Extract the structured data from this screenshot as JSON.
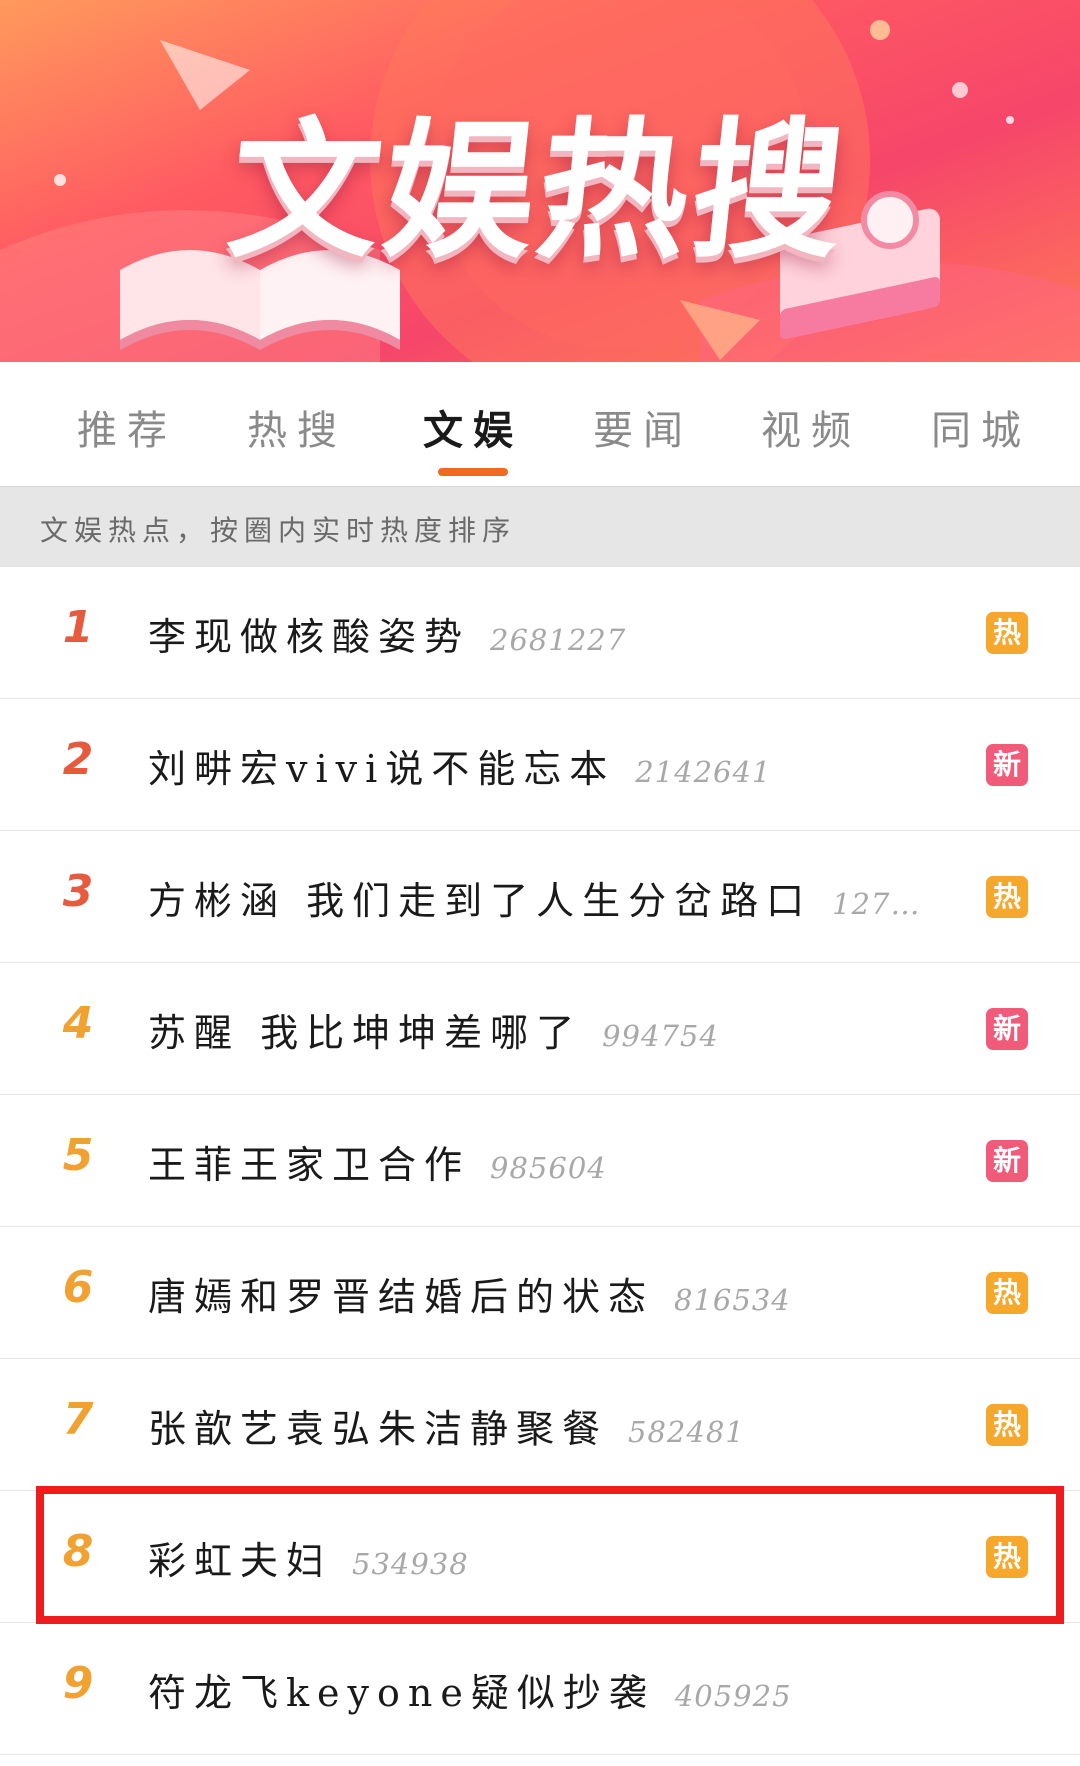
{
  "banner": {
    "title": "文娱热搜",
    "colors": {
      "primary": "#f6466a",
      "secondary": "#ff9a5c"
    }
  },
  "tabs": [
    {
      "label": "推荐",
      "active": false
    },
    {
      "label": "热搜",
      "active": false
    },
    {
      "label": "文娱",
      "active": true
    },
    {
      "label": "要闻",
      "active": false
    },
    {
      "label": "视频",
      "active": false
    },
    {
      "label": "同城",
      "active": false
    }
  ],
  "info": {
    "text": "文娱热点，按圈内实时热度排序"
  },
  "list": [
    {
      "rank": "1",
      "title": "李现做核酸姿势",
      "count": "2681227",
      "badge": "热"
    },
    {
      "rank": "2",
      "title": "刘畊宏vivi说不能忘本",
      "count": "2142641",
      "badge": "新"
    },
    {
      "rank": "3",
      "title": "方彬涵 我们走到了人生分岔路口",
      "count": "127…",
      "badge": "热"
    },
    {
      "rank": "4",
      "title": "苏醒 我比坤坤差哪了",
      "count": "994754",
      "badge": "新"
    },
    {
      "rank": "5",
      "title": "王菲王家卫合作",
      "count": "985604",
      "badge": "新"
    },
    {
      "rank": "6",
      "title": "唐嫣和罗晋结婚后的状态",
      "count": "816534",
      "badge": "热"
    },
    {
      "rank": "7",
      "title": "张歆艺袁弘朱洁静聚餐",
      "count": "582481",
      "badge": "热"
    },
    {
      "rank": "8",
      "title": "彩虹夫妇",
      "count": "534938",
      "badge": "热"
    },
    {
      "rank": "9",
      "title": "符龙飞keyone疑似抄袭",
      "count": "405925",
      "badge": ""
    }
  ],
  "colors": {
    "tab_indicator": "#f06a20",
    "rank_top": "#e85a3e",
    "rank": "#f1a130",
    "badge_hot": "#f7a72c",
    "badge_new": "#f25a7a",
    "highlight_box": "#ee1c1c"
  },
  "highlighted_rank": "8"
}
